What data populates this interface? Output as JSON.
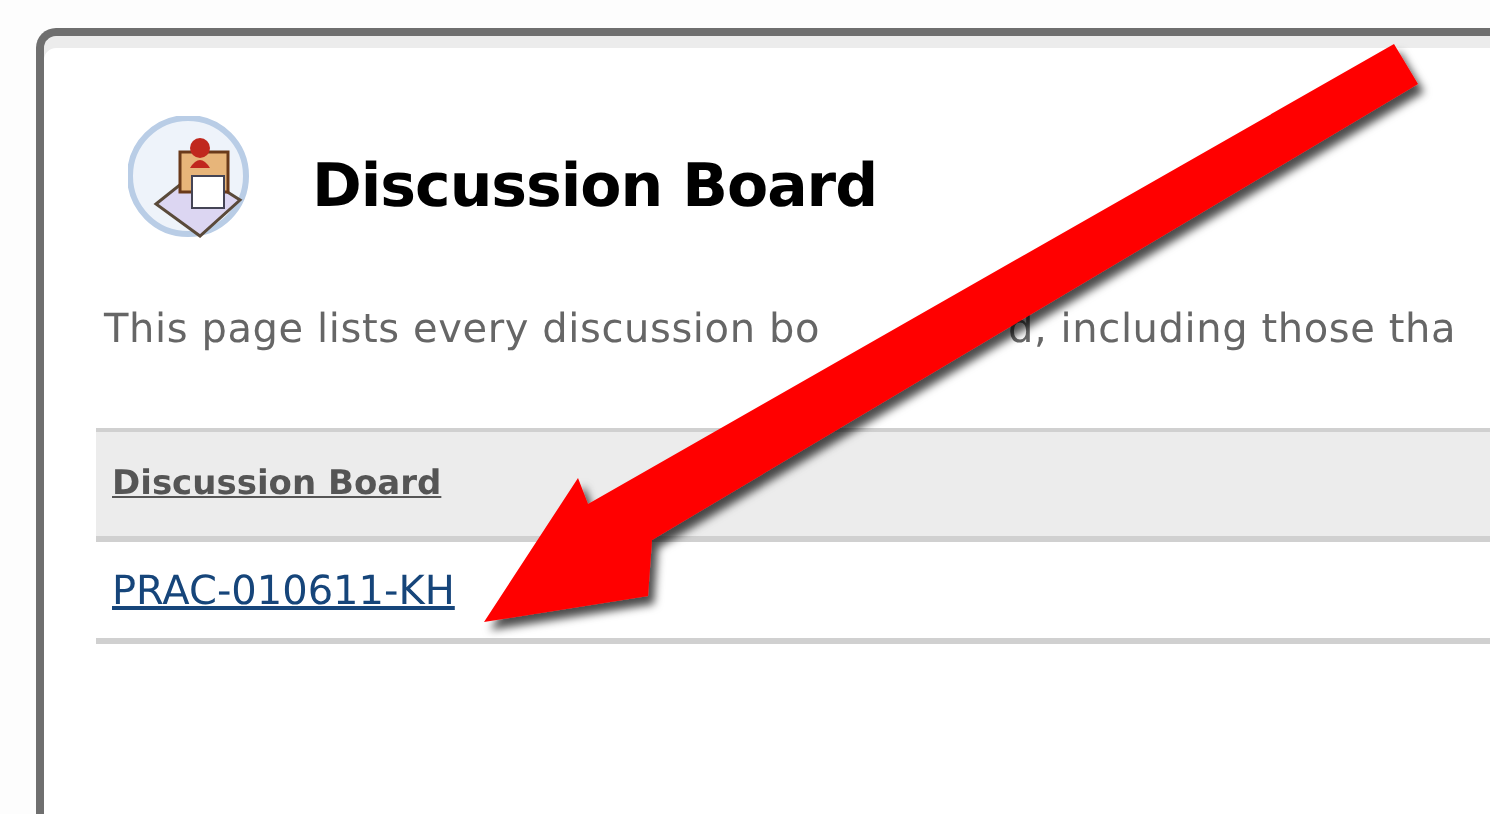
{
  "page": {
    "title": "Discussion Board",
    "description_before_arrow": "This page lists every discussion bo",
    "description_after_arrow": "d, including those tha"
  },
  "table": {
    "columns": [
      "Discussion Board"
    ],
    "rows": [
      {
        "name": "PRAC-010611-KH"
      }
    ]
  }
}
